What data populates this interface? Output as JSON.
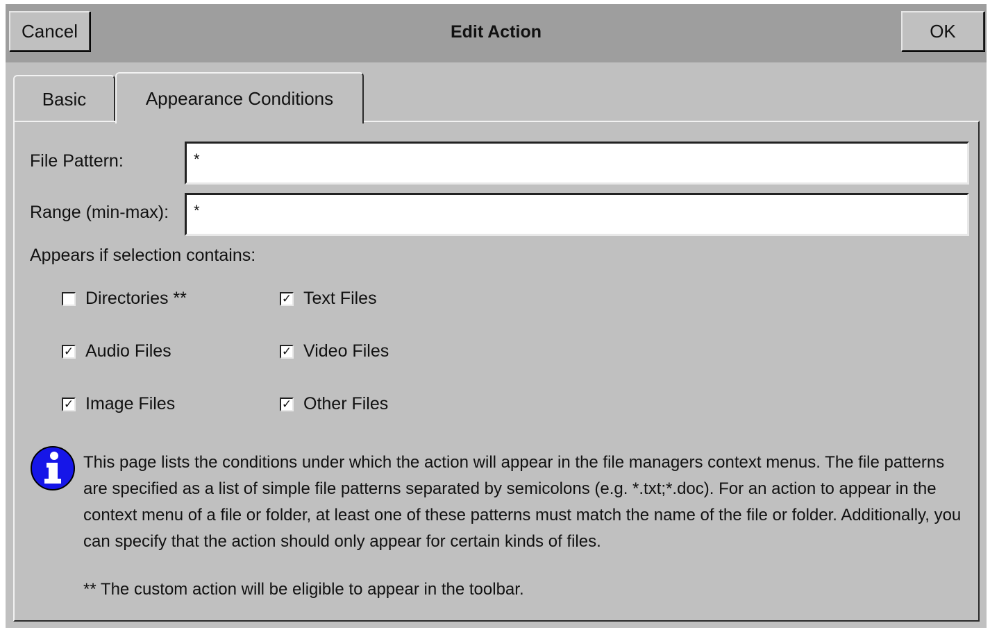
{
  "window": {
    "title": "Edit Action",
    "cancel_label": "Cancel",
    "ok_label": "OK"
  },
  "tabs": [
    {
      "label": "Basic",
      "active": false
    },
    {
      "label": "Appearance Conditions",
      "active": true
    }
  ],
  "form": {
    "file_pattern": {
      "label": "File Pattern:",
      "value": "*"
    },
    "range": {
      "label": "Range (min-max):",
      "value": "*"
    }
  },
  "selection": {
    "heading": "Appears if selection contains:",
    "checkboxes": [
      {
        "label": "Directories **",
        "checked": false
      },
      {
        "label": "Text Files",
        "checked": true
      },
      {
        "label": "Audio Files",
        "checked": true
      },
      {
        "label": "Video Files",
        "checked": true
      },
      {
        "label": "Image Files",
        "checked": true
      },
      {
        "label": "Other Files",
        "checked": true
      }
    ]
  },
  "info": {
    "icon": "info-icon",
    "text": "This page lists the conditions under which the action will appear in the file managers context menus. The file patterns are specified as a list of simple file patterns separated by semicolons (e.g. *.txt;*.doc). For an action to appear in the context menu of a file or folder, at least one of these patterns must match the name of the file or folder. Additionally, you can specify that the action should only appear for certain kinds of files.",
    "footnote": "** The custom action will be eligible to appear in the toolbar."
  },
  "check_mark": "✓"
}
